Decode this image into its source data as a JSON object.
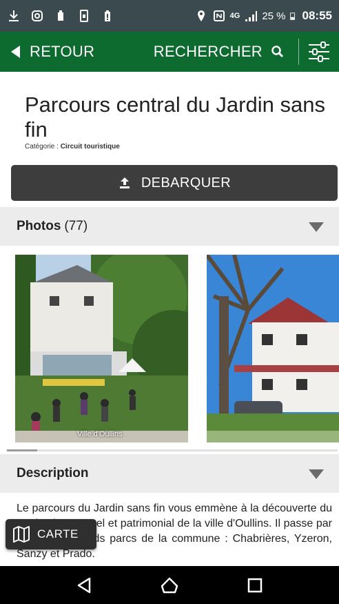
{
  "status_bar": {
    "network": "4G",
    "battery_pct": "25 %",
    "time": "08:55"
  },
  "app_bar": {
    "back_label": "RETOUR",
    "search_label": "RECHERCHER"
  },
  "page": {
    "title": "Parcours central du Jardin sans fin",
    "category_label": "Catégorie :",
    "category_value": "Circuit touristique"
  },
  "actions": {
    "debarquer_label": "DEBARQUER",
    "carte_label": "CARTE"
  },
  "photos": {
    "label": "Photos",
    "count": "(77)",
    "caption_1": "Ville d'Oullins"
  },
  "description": {
    "label": "Description",
    "text": "Le parcours du Jardin sans fin vous emmène à la découverte du patrimoine naturel et patrimonial de la ville d'Oullins. Il passe par les quatre grands parcs de la commune : Chabrières, Yzeron, Sanzy et Prado."
  },
  "colors": {
    "app_bar": "#0d6b2f",
    "status_bar": "#3a4a4e",
    "button_dark": "#3d3d3d",
    "section_bg": "#ececec"
  }
}
